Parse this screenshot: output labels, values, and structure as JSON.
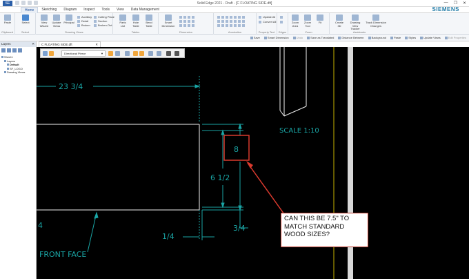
{
  "window": {
    "app_badge": "SE",
    "title": "Solid Edge 2021 - Draft - [C FLOATING SIDE.dft]",
    "controls": [
      "—",
      "❐",
      "✕"
    ]
  },
  "ribbon": {
    "tabs": [
      "Home",
      "Sketching",
      "Diagram",
      "Inspect",
      "Tools",
      "View",
      "Data Management"
    ],
    "active_tab": "Home",
    "brand": "SIEMENS",
    "groups": {
      "clipboard": {
        "label": "Clipboard",
        "paste": "Paste"
      },
      "select": {
        "label": "Select",
        "select": "Select"
      },
      "drawing_views": {
        "label": "Drawing Views",
        "buttons": [
          "View Wizard",
          "Update Views",
          "Principal"
        ],
        "small": [
          "Auxiliary",
          "Detail",
          "Broken",
          "Cutting Plane",
          "Section",
          "Broken-Out"
        ]
      },
      "tables": {
        "label": "Tables",
        "buttons": [
          "Parts List",
          "Hole Table",
          "Bend Table"
        ]
      },
      "dimension": {
        "label": "Dimension",
        "buttons": [
          "Smart Dimension"
        ]
      },
      "annotation": {
        "label": "Annotation"
      },
      "property_text": {
        "label": "Property Text",
        "small": [
          "Update All",
          "Convert All"
        ]
      },
      "edges": {
        "label": "Edges"
      },
      "zoom": {
        "label": "Zoom",
        "buttons": [
          "Zoom Area",
          "Zoom Tool",
          "Fit"
        ]
      },
      "assistants": {
        "label": "Assistants",
        "buttons": [
          "Create 3D",
          "Drawing View Tracker",
          "Track Dimension Changes"
        ]
      }
    }
  },
  "command_bar": {
    "items": [
      {
        "label": "Save",
        "enabled": true
      },
      {
        "label": "Smart Dimension",
        "enabled": true
      },
      {
        "label": "Undo",
        "enabled": false
      },
      {
        "label": "Save as Translated",
        "enabled": true
      },
      {
        "label": "Distance Between",
        "enabled": true
      },
      {
        "label": "Background",
        "enabled": true
      },
      {
        "label": "Paste",
        "enabled": true
      },
      {
        "label": "Styles",
        "enabled": true
      },
      {
        "label": "Update Views",
        "enabled": true
      },
      {
        "label": "Edit Properties",
        "enabled": false
      }
    ]
  },
  "layers_pane": {
    "title": "Layers",
    "tree": [
      {
        "label": "Sheet1",
        "level": 0
      },
      {
        "label": "Layers",
        "level": 1
      },
      {
        "label": "Default",
        "level": 2
      },
      {
        "label": "SF_LOGO",
        "level": 2
      },
      {
        "label": "Drawing Views",
        "level": 1
      }
    ]
  },
  "document": {
    "tab_title": "C FLOATING SIDE.dft",
    "close_glyph": "✕",
    "view_toolbar": {
      "dropdown_value": "Directional Pierce"
    }
  },
  "drawing": {
    "dims": {
      "top_width": "23 3/4",
      "height_boxed": "8",
      "height": "6 1/2",
      "offset_right": "3/4",
      "offset_left": "1/4",
      "partial_left": "4"
    },
    "scale_label": "SCALE 1:10",
    "view_label": "FRONT FACE",
    "colors": {
      "canvas": "#000000",
      "dimension": "#1aa5a5",
      "geometry": "#f2f2f2",
      "markup": "#d93a2e",
      "centerline": "#c8b400"
    }
  },
  "markup": {
    "callout_text": "CAN THIS BE 7.5\" TO MATCH STANDARD WOOD SIZES?"
  }
}
